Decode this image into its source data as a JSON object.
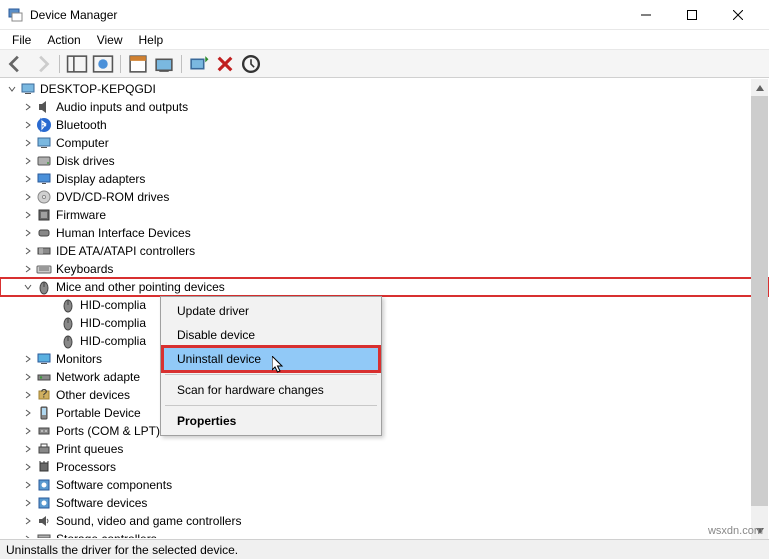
{
  "window": {
    "title": "Device Manager"
  },
  "menu": {
    "file": "File",
    "action": "Action",
    "view": "View",
    "help": "Help"
  },
  "root": "DESKTOP-KEPQGDI",
  "categories": [
    {
      "label": "Audio inputs and outputs",
      "icon": "speaker"
    },
    {
      "label": "Bluetooth",
      "icon": "bluetooth"
    },
    {
      "label": "Computer",
      "icon": "computer"
    },
    {
      "label": "Disk drives",
      "icon": "disk"
    },
    {
      "label": "Display adapters",
      "icon": "display"
    },
    {
      "label": "DVD/CD-ROM drives",
      "icon": "dvd"
    },
    {
      "label": "Firmware",
      "icon": "firmware"
    },
    {
      "label": "Human Interface Devices",
      "icon": "hid"
    },
    {
      "label": "IDE ATA/ATAPI controllers",
      "icon": "ide"
    },
    {
      "label": "Keyboards",
      "icon": "keyboard"
    }
  ],
  "mice_category": {
    "label": "Mice and other pointing devices",
    "children": [
      {
        "label": "HID-complia"
      },
      {
        "label": "HID-complia"
      },
      {
        "label": "HID-complia"
      }
    ]
  },
  "categories_after": [
    {
      "label": "Monitors",
      "icon": "monitor"
    },
    {
      "label": "Network adapte",
      "icon": "network"
    },
    {
      "label": "Other devices",
      "icon": "other"
    },
    {
      "label": "Portable Device",
      "icon": "portable"
    },
    {
      "label": "Ports (COM & LPT)",
      "icon": "ports"
    },
    {
      "label": "Print queues",
      "icon": "print"
    },
    {
      "label": "Processors",
      "icon": "processor"
    },
    {
      "label": "Software components",
      "icon": "software"
    },
    {
      "label": "Software devices",
      "icon": "software"
    },
    {
      "label": "Sound, video and game controllers",
      "icon": "sound"
    },
    {
      "label": "Storage controllers",
      "icon": "storage"
    }
  ],
  "context_menu": {
    "update": "Update driver",
    "disable": "Disable device",
    "uninstall": "Uninstall device",
    "scan": "Scan for hardware changes",
    "properties": "Properties"
  },
  "status": "Uninstalls the driver for the selected device.",
  "watermark": "wsxdn.com"
}
